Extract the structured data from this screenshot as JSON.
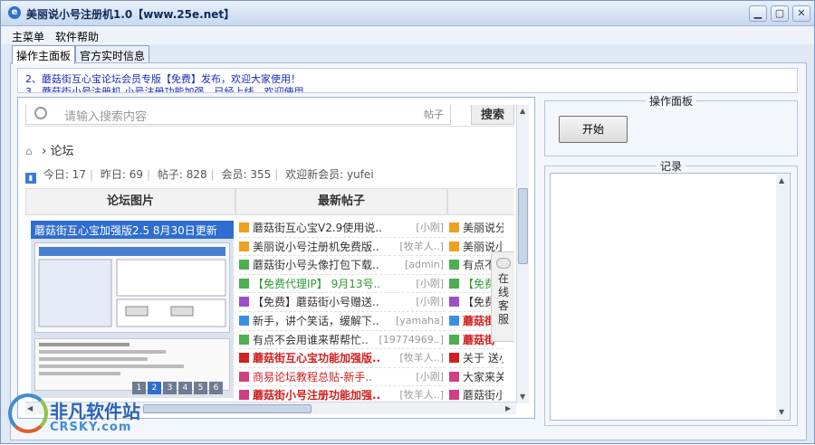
{
  "window": {
    "title": "美丽说小号注册机1.0【www.25e.net】",
    "min": "▭",
    "max": "▭",
    "close": "✕"
  },
  "menu": [
    "主菜单",
    "软件帮助"
  ],
  "tabs": [
    "操作主面板",
    "官方实时信息"
  ],
  "notice": {
    "line1": "2、蘑菇街互心宝论坛会员专版【免费】发布，欢迎大家使用！",
    "line2": "3、蘑菇街小号注册机 小号注册功能加强，已经上线，欢迎使用"
  },
  "web": {
    "search_placeholder": "请输入搜索内容",
    "search_scope": "帖子",
    "search_button": "搜索",
    "breadcrumb": "论坛",
    "stats": [
      "今日: 17",
      "昨日: 69",
      "帖子: 828",
      "会员: 355",
      "欢迎新会员: yufei"
    ],
    "col_pics": "论坛图片",
    "col_posts": "最新帖子",
    "pic_caption": "蘑菇街互心宝加强版2.5 8月30日更新",
    "pager": [
      "1",
      "2",
      "3",
      "4",
      "5",
      "6"
    ],
    "posts": [
      {
        "title": "蘑菇街互心宝V2.9使用说..",
        "author": "[小刚]",
        "color": "#333333",
        "icon": "#f0a020"
      },
      {
        "title": "美丽说小号注册机免费版..",
        "author": "[牧羊人..]",
        "color": "#333333",
        "icon": "#f0a020"
      },
      {
        "title": "蘑菇街小号头像打包下载..",
        "author": "[admin]",
        "color": "#333333",
        "icon": "#4caf50"
      },
      {
        "title": "【免费代理IP】 9月13号..",
        "author": "[小刚]",
        "color": "#2e9a2e",
        "icon": "#4caf50"
      },
      {
        "title": "【免费】蘑菇街小号赠送..",
        "author": "[小刚]",
        "color": "#333333",
        "icon": "#9c4fc8"
      },
      {
        "title": "新手，讲个笑话，缓解下..",
        "author": "[yamaha]",
        "color": "#333333",
        "icon": "#3a8ee6"
      },
      {
        "title": "有点不会用谁来帮帮忙..",
        "author": "[19774969..]",
        "color": "#333333",
        "icon": "#4caf50"
      },
      {
        "title": "蘑菇街互心宝功能加强版..",
        "author": "[牧羊人..]",
        "color": "#d02020",
        "icon": "#d02020",
        "bold": true
      },
      {
        "title": "商易论坛教程总贴-新手..",
        "author": "[小刚]",
        "color": "#d02020",
        "icon": "#d04080"
      },
      {
        "title": "蘑菇街小号注册功能加强..",
        "author": "[牧羊人..]",
        "color": "#d02020",
        "icon": "#d04080",
        "bold": true
      }
    ],
    "posts_right": [
      {
        "title": "美丽说分享",
        "color": "#333333",
        "icon": "#f0a020"
      },
      {
        "title": "美丽说小号",
        "color": "#333333",
        "icon": "#f0a020"
      },
      {
        "title": "有点不会",
        "color": "#333333",
        "icon": "#4caf50"
      },
      {
        "title": "【免费",
        "color": "#2e9a2e",
        "icon": "#4caf50"
      },
      {
        "title": "【免费",
        "color": "#333333",
        "icon": "#9c4fc8"
      },
      {
        "title": "蘑菇街",
        "color": "#d02020",
        "icon": "#3a8ee6",
        "bold": true
      },
      {
        "title": "蘑菇街",
        "color": "#d02020",
        "icon": "#4caf50",
        "bold": true
      },
      {
        "title": "关于 送小",
        "color": "#333333",
        "icon": "#d02020"
      },
      {
        "title": "大家来关注",
        "color": "#333333",
        "icon": "#d04080"
      },
      {
        "title": "蘑菇街小号",
        "color": "#333333",
        "icon": "#d04080"
      }
    ],
    "chat_label": "在线客服"
  },
  "ops": {
    "group_title": "操作面板",
    "start_button": "开始"
  },
  "log": {
    "group_title": "记录"
  },
  "watermark": {
    "cn": "非凡软件站",
    "en": "CRSKY.com"
  }
}
